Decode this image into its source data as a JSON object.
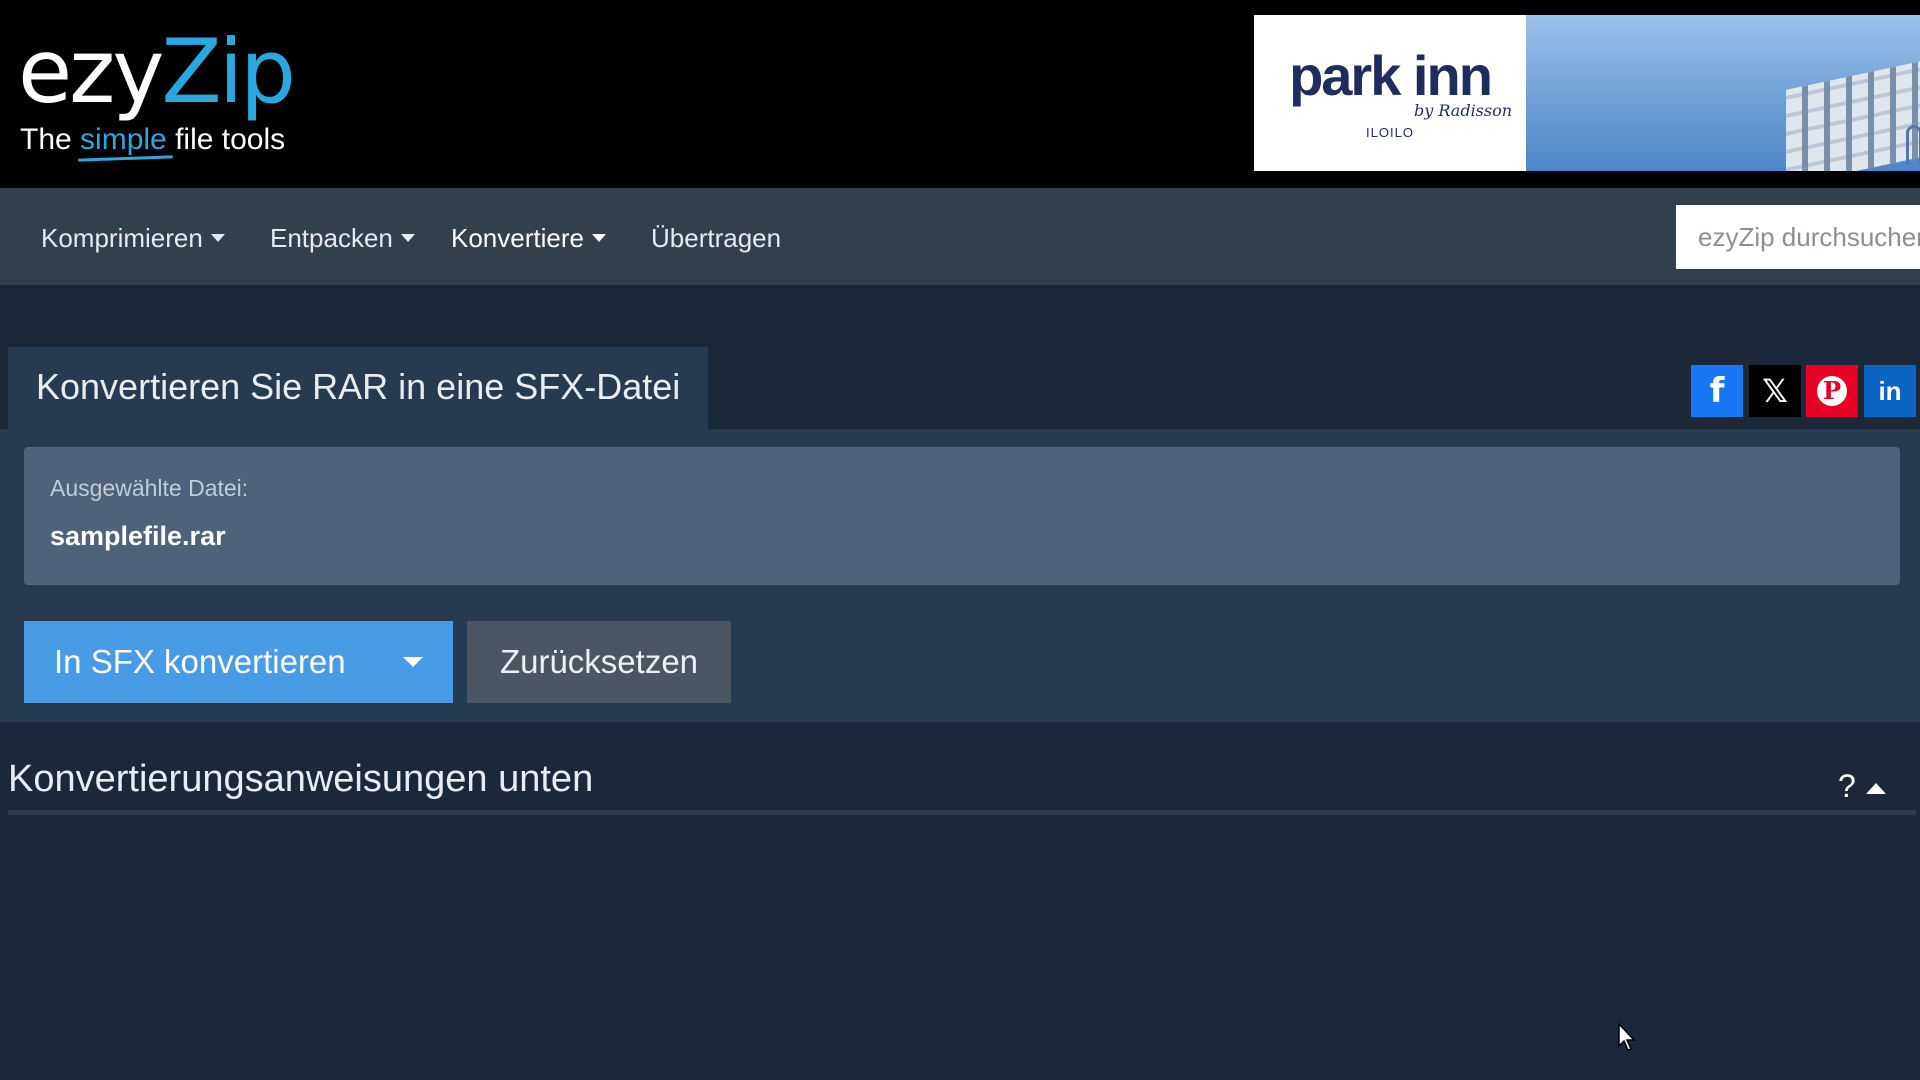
{
  "logo": {
    "word_a": "ezy",
    "word_b": "Zip",
    "tag_a": "The",
    "tag_b": "simple",
    "tag_c": "file tools"
  },
  "ad": {
    "brand": "park inn",
    "by": "by Radisson",
    "city": "ILOILO"
  },
  "nav": {
    "items": [
      {
        "label": "Komprimieren",
        "dropdown": true
      },
      {
        "label": "Entpacken",
        "dropdown": true
      },
      {
        "label": "Konvertiere",
        "dropdown": true,
        "active": true
      },
      {
        "label": "Übertragen",
        "dropdown": false
      }
    ],
    "search_placeholder": "ezyZip durchsuchen"
  },
  "page": {
    "title": "Konvertieren Sie RAR in eine SFX-Datei",
    "selected_label": "Ausgewählte Datei:",
    "selected_file": "samplefile.rar",
    "convert_label": "In SFX konvertieren",
    "reset_label": "Zurücksetzen",
    "instructions_title": "Konvertierungsanweisungen unten",
    "help_glyph": "?"
  },
  "social": {
    "facebook": "f",
    "x": "𝕏",
    "pinterest": "P",
    "linkedin": "in"
  },
  "colors": {
    "accent": "#29a8e0",
    "primary_button": "#4a9be6",
    "panel": "#263a52",
    "background": "#1a283a"
  }
}
